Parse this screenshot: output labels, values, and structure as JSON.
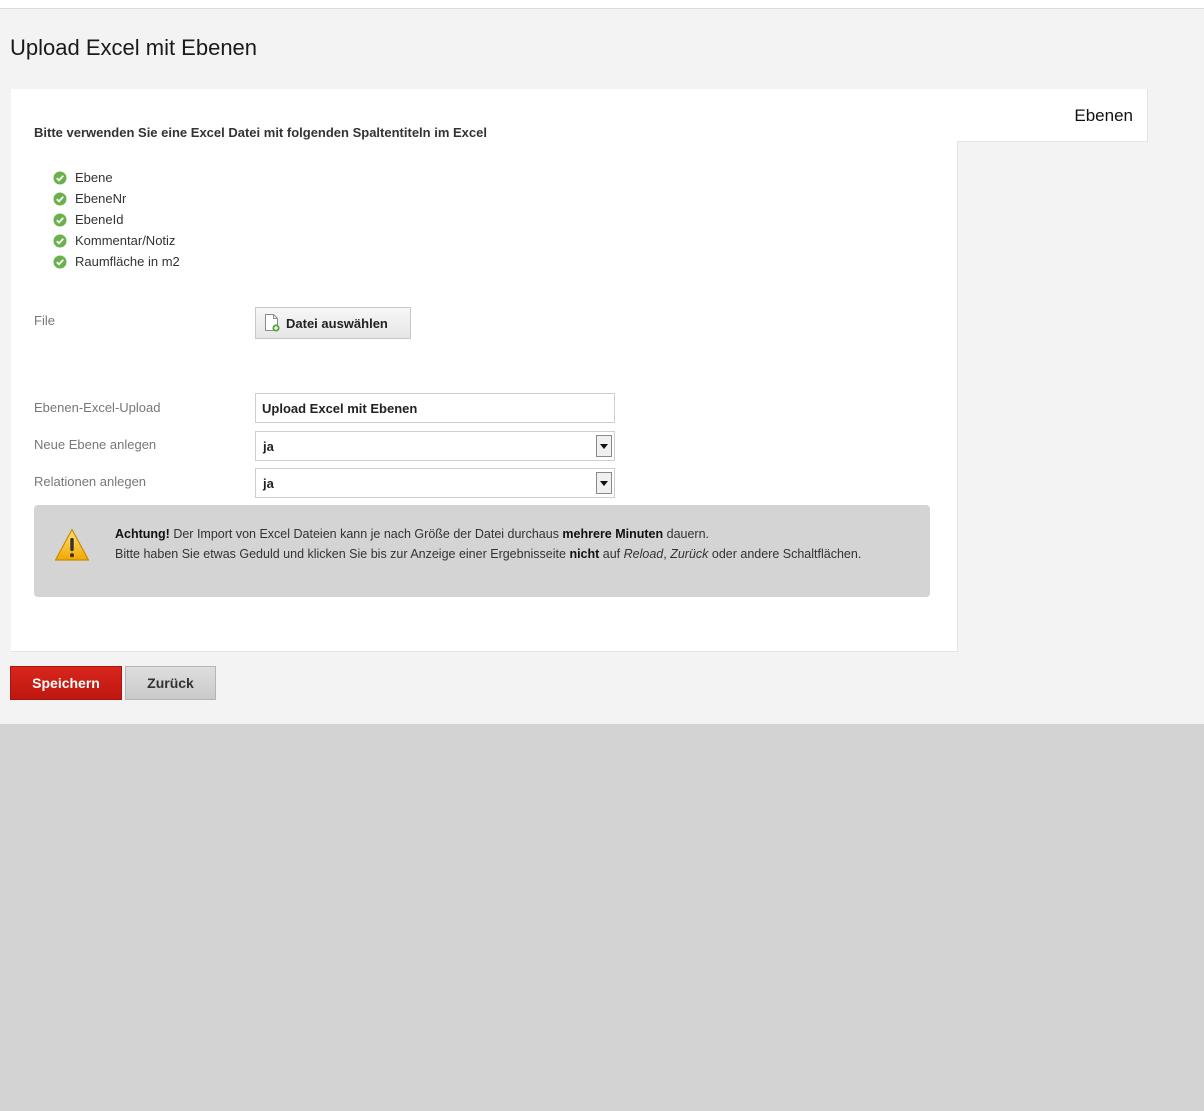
{
  "page": {
    "title": "Upload Excel mit Ebenen"
  },
  "tab": {
    "label": "Ebenen"
  },
  "instructions": {
    "heading": "Bitte verwenden Sie eine Excel Datei mit folgenden Spaltentiteln im Excel",
    "columns": [
      "Ebene",
      "EbeneNr",
      "EbeneId",
      "Kommentar/Notiz",
      "Raumfläche in m2"
    ],
    "icon": "check-circle-icon"
  },
  "form": {
    "file_label": "File",
    "file_button_label": "Datei auswählen",
    "upload_label": "Ebenen-Excel-Upload",
    "upload_value": "Upload Excel mit Ebenen",
    "new_level_label": "Neue Ebene anlegen",
    "new_level_value": "ja",
    "relations_label": "Relationen anlegen",
    "relations_value": "ja"
  },
  "warning": {
    "icon": "warning-icon",
    "strong_prefix": "Achtung!",
    "line1_part1": " Der Import von Excel Dateien kann je nach Größe der Datei durchaus ",
    "line1_bold": "mehrere Minuten",
    "line1_part2": " dauern.",
    "line2_part1": "Bitte haben Sie etwas Geduld und klicken Sie bis zur Anzeige einer Ergebnisseite ",
    "line2_bold": "nicht",
    "line2_part2": " auf ",
    "line2_italic1": "Reload",
    "line2_part3": ", ",
    "line2_italic2": "Zurück",
    "line2_part4": " oder andere Schaltflächen."
  },
  "actions": {
    "save_label": "Speichern",
    "back_label": "Zurück"
  },
  "colors": {
    "primary": "#c81e16",
    "check": "#6ab04c",
    "warning": "#f2b81c"
  }
}
